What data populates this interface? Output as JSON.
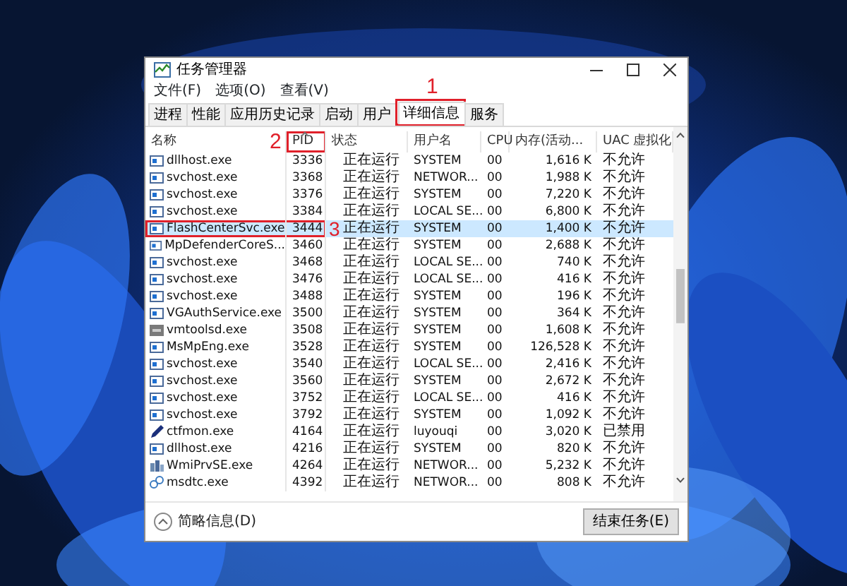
{
  "window": {
    "title": "任务管理器"
  },
  "menu": [
    "文件(F)",
    "选项(O)",
    "查看(V)"
  ],
  "tabs": [
    {
      "label": "进程",
      "selected": false
    },
    {
      "label": "性能",
      "selected": false
    },
    {
      "label": "应用历史记录",
      "selected": false
    },
    {
      "label": "启动",
      "selected": false
    },
    {
      "label": "用户",
      "selected": false
    },
    {
      "label": "详细信息",
      "selected": true,
      "annotation": "1"
    },
    {
      "label": "服务",
      "selected": false
    }
  ],
  "table": {
    "columns": [
      {
        "label": "名称",
        "sorted": false
      },
      {
        "label": "PID",
        "sorted": true,
        "annotation": "2"
      },
      {
        "label": "状态",
        "sorted": false
      },
      {
        "label": "用户名",
        "sorted": false
      },
      {
        "label": "CPU",
        "sorted": false
      },
      {
        "label": "内存(活动...",
        "sorted": false
      },
      {
        "label": "UAC 虚拟化",
        "sorted": false
      }
    ],
    "rows": [
      {
        "kind": "app",
        "selected": false,
        "cells": [
          "dllhost.exe",
          "3336",
          "正在运行",
          "SYSTEM",
          "00",
          "1,616 K",
          "不允许"
        ]
      },
      {
        "kind": "app",
        "selected": false,
        "cells": [
          "svchost.exe",
          "3368",
          "正在运行",
          "NETWOR...",
          "00",
          "1,988 K",
          "不允许"
        ]
      },
      {
        "kind": "app",
        "selected": false,
        "cells": [
          "svchost.exe",
          "3376",
          "正在运行",
          "SYSTEM",
          "00",
          "7,220 K",
          "不允许"
        ]
      },
      {
        "kind": "app",
        "selected": false,
        "cells": [
          "svchost.exe",
          "3384",
          "正在运行",
          "LOCAL SE...",
          "00",
          "6,800 K",
          "不允许"
        ]
      },
      {
        "kind": "app",
        "selected": true,
        "annotation": "3",
        "cells": [
          "FlashCenterSvc.exe",
          "3444",
          "正在运行",
          "SYSTEM",
          "00",
          "1,400 K",
          "不允许"
        ]
      },
      {
        "kind": "app",
        "selected": false,
        "cells": [
          "MpDefenderCoreS...",
          "3460",
          "正在运行",
          "SYSTEM",
          "00",
          "2,688 K",
          "不允许"
        ]
      },
      {
        "kind": "app",
        "selected": false,
        "cells": [
          "svchost.exe",
          "3468",
          "正在运行",
          "LOCAL SE...",
          "00",
          "740 K",
          "不允许"
        ]
      },
      {
        "kind": "app",
        "selected": false,
        "cells": [
          "svchost.exe",
          "3476",
          "正在运行",
          "LOCAL SE...",
          "00",
          "416 K",
          "不允许"
        ]
      },
      {
        "kind": "app",
        "selected": false,
        "cells": [
          "svchost.exe",
          "3488",
          "正在运行",
          "SYSTEM",
          "00",
          "196 K",
          "不允许"
        ]
      },
      {
        "kind": "app",
        "selected": false,
        "cells": [
          "VGAuthService.exe",
          "3500",
          "正在运行",
          "SYSTEM",
          "00",
          "364 K",
          "不允许"
        ]
      },
      {
        "kind": "vm",
        "selected": false,
        "cells": [
          "vmtoolsd.exe",
          "3508",
          "正在运行",
          "SYSTEM",
          "00",
          "1,608 K",
          "不允许"
        ]
      },
      {
        "kind": "app",
        "selected": false,
        "cells": [
          "MsMpEng.exe",
          "3528",
          "正在运行",
          "SYSTEM",
          "00",
          "126,528 K",
          "不允许"
        ]
      },
      {
        "kind": "app",
        "selected": false,
        "cells": [
          "svchost.exe",
          "3540",
          "正在运行",
          "LOCAL SE...",
          "00",
          "2,416 K",
          "不允许"
        ]
      },
      {
        "kind": "app",
        "selected": false,
        "cells": [
          "svchost.exe",
          "3560",
          "正在运行",
          "SYSTEM",
          "00",
          "2,672 K",
          "不允许"
        ]
      },
      {
        "kind": "app",
        "selected": false,
        "cells": [
          "svchost.exe",
          "3752",
          "正在运行",
          "LOCAL SE...",
          "00",
          "416 K",
          "不允许"
        ]
      },
      {
        "kind": "app",
        "selected": false,
        "cells": [
          "svchost.exe",
          "3792",
          "正在运行",
          "SYSTEM",
          "00",
          "1,092 K",
          "不允许"
        ]
      },
      {
        "kind": "pen",
        "selected": false,
        "cells": [
          "ctfmon.exe",
          "4164",
          "正在运行",
          "luyouqi",
          "00",
          "3,020 K",
          "已禁用"
        ]
      },
      {
        "kind": "app",
        "selected": false,
        "cells": [
          "dllhost.exe",
          "4216",
          "正在运行",
          "SYSTEM",
          "00",
          "820 K",
          "不允许"
        ]
      },
      {
        "kind": "wmi",
        "selected": false,
        "cells": [
          "WmiPrvSE.exe",
          "4264",
          "正在运行",
          "NETWOR...",
          "00",
          "5,232 K",
          "不允许"
        ]
      },
      {
        "kind": "net",
        "selected": false,
        "cells": [
          "msdtc.exe",
          "4392",
          "正在运行",
          "NETWOR...",
          "00",
          "808 K",
          "不允许"
        ]
      }
    ]
  },
  "footer": {
    "details_link": "简略信息(D)",
    "end_task_button": "结束任务(E)"
  }
}
